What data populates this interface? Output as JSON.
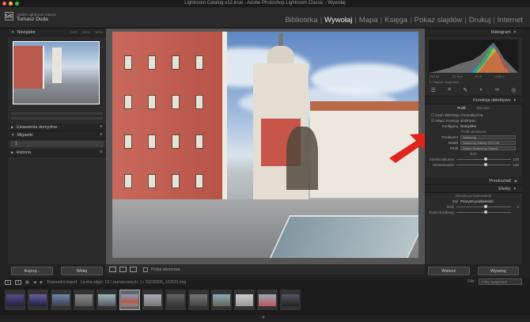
{
  "window": {
    "title": "Lightroom Catalog-v12.lrcat - Adobe Photoshop Lightroom Classic - Wywołaj"
  },
  "brand": {
    "logo": "LrC",
    "app": "Adobe Lightroom Classic",
    "user": "Tomasz Duda"
  },
  "modules": [
    "Biblioteka",
    "Wywołaj",
    "Mapa",
    "Księga",
    "Pokaz slajdów",
    "Drukuj",
    "Internet"
  ],
  "active_module": "Wywołaj",
  "left": {
    "navigator": {
      "title": "Navigator",
      "zoom_options": [
        "DOP",
        "100%",
        "300%"
      ]
    },
    "presets_label": "Ustawienia domyślne",
    "snapshots_label": "Migawki",
    "snapshot_item": "1",
    "history_label": "Historia",
    "copy_button": "Kopiuj...",
    "paste_button": "Wklej"
  },
  "toolbar": {
    "soft_proof": "Próba ekranowa"
  },
  "right": {
    "histogram_title": "Histogram",
    "histogram_info": [
      "ISO 64",
      "4,7 mm",
      "f/1.8",
      "1/100 s"
    ],
    "original_photo": "Zdjęcie oryginalne",
    "lens_title": "Korekcja obiektywu",
    "tabs": [
      "Profil",
      "Ręcznie"
    ],
    "active_tab": "Profil",
    "checkboxes": [
      "Usuń aberrację chromatyczną",
      "Włącz korekcję obiektywu"
    ],
    "config_label": "Konfiguruj",
    "config_value": "Domyślne",
    "profile_header": "Profil obiektywu",
    "make_label": "Producent",
    "make_value": "Samsung",
    "model_label": "Model",
    "model_value": "Samsung Galaxy S23 Ultr",
    "profile_label": "Profil",
    "profile_value": "Adobe (Samsung Galaxy",
    "amount_header": "Ilość",
    "distortion_label": "Zniekształcanie",
    "distortion_value": "100",
    "vignetting_label": "Winietowanie",
    "vignetting_value": "100",
    "transform_title": "Przekształć",
    "effects_title": "Efekty",
    "vignette_header": "Winieta po kadrowaniu",
    "style_label": "Styl",
    "style_value": "Priorytet podświetleń",
    "amount_label": "Ilość",
    "amount_value": "0",
    "center_label": "Punkt środkowy",
    "center_value": "",
    "prev_button": "Wstecz",
    "reset_button": "Wyzeruj"
  },
  "filmstrip": {
    "source": "Poprzedni import",
    "count": "Liczba zdjęć: 13 / zaznaczonych: 1 / 20230205_122632.dng",
    "filter_label": "Filtr:",
    "filter_value": "Filtry wyłączone",
    "screen_buttons": [
      "1",
      "2"
    ]
  },
  "colors": {
    "accent_arrow": "#e0251b",
    "panel": "#2b2b2b",
    "background": "#222222"
  }
}
